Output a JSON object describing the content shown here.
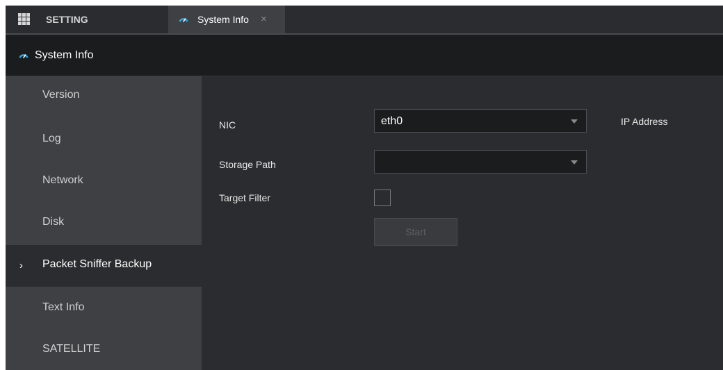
{
  "tabbar": {
    "setting_label": "SETTING",
    "active_tab": {
      "label": "System Info",
      "close": "×"
    }
  },
  "header": {
    "title": "System Info"
  },
  "sidebar": {
    "items": [
      {
        "label": "Version"
      },
      {
        "label": "Log"
      },
      {
        "label": "Network"
      },
      {
        "label": "Disk"
      },
      {
        "label": "Packet Sniffer Backup",
        "active": true,
        "chevron": "›"
      },
      {
        "label": "Text Info"
      },
      {
        "label": "SATELLITE"
      }
    ]
  },
  "form": {
    "nic_label": "NIC",
    "nic_value": "eth0",
    "ip_address_label": "IP Address",
    "storage_path_label": "Storage Path",
    "storage_path_value": "",
    "target_filter_label": "Target Filter",
    "target_filter_checked": false,
    "start_label": "Start"
  },
  "colors": {
    "background": "#2b2c2f",
    "header_background": "#1b1c1e",
    "sidebar_background": "#3f4043",
    "icon_accent": "#29a8e0"
  },
  "icons": {
    "apps": "grid-icon",
    "tab": "gauge-icon",
    "header": "gauge-icon",
    "dropdown": "caret-down-icon"
  }
}
